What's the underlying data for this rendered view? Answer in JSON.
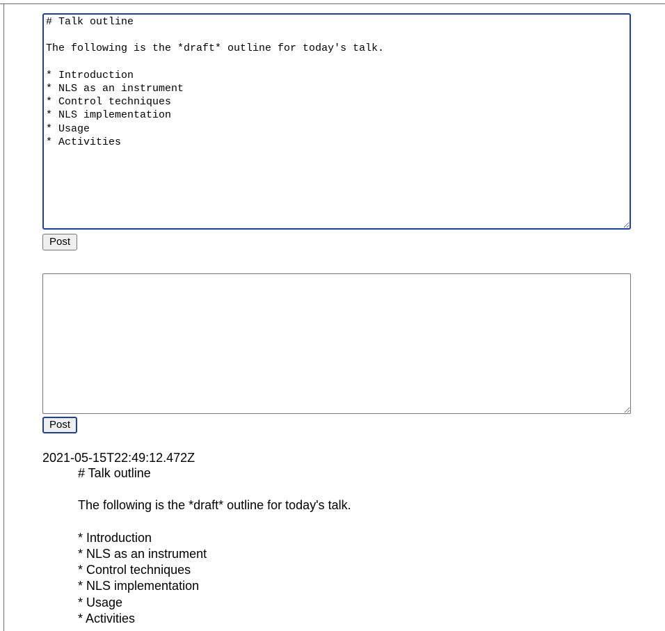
{
  "composer_primary": {
    "value": "# Talk outline\n\nThe following is the *draft* outline for today's talk.\n\n* Introduction\n* NLS as an instrument\n* Control techniques\n* NLS implementation\n* Usage\n* Activities",
    "post_label": "Post"
  },
  "composer_secondary": {
    "value": "",
    "post_label": "Post"
  },
  "posts": [
    {
      "timestamp": "2021-05-15T22:49:12.472Z",
      "body": "# Talk outline\n\nThe following is the *draft* outline for today's talk.\n\n* Introduction\n* NLS as an instrument\n* Control techniques\n* NLS implementation\n* Usage\n* Activities"
    }
  ],
  "colors": {
    "focus_ring": "#1a3fb3",
    "button_bg": "#efefef",
    "border": "#767676"
  }
}
